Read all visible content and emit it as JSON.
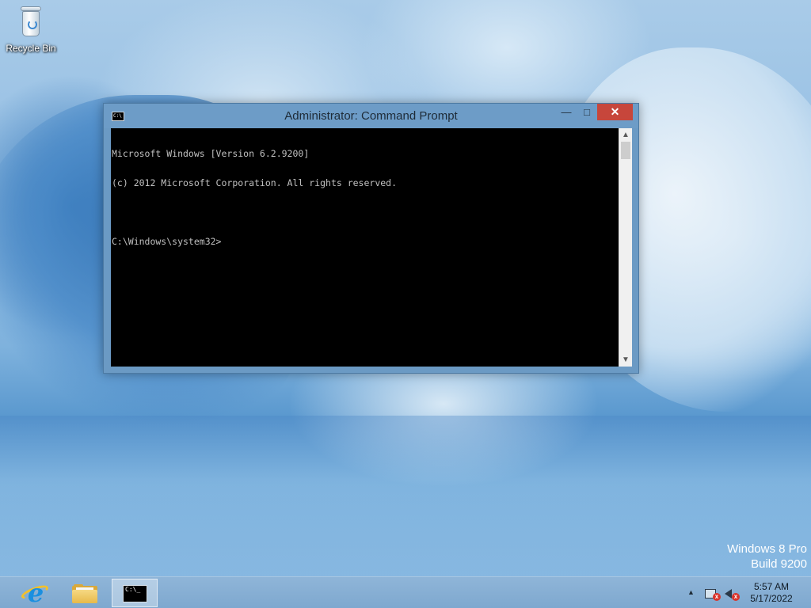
{
  "desktop": {
    "icons": [
      {
        "label": "Recycle Bin",
        "icon": "recycle-bin-icon"
      }
    ],
    "watermark": {
      "line1": "Windows 8 Pro",
      "line2": "Build 9200"
    }
  },
  "window": {
    "title": "Administrator: Command Prompt",
    "icon": "command-prompt-icon",
    "controls": {
      "minimize": "—",
      "maximize": "□",
      "close": "✕"
    },
    "console_lines": [
      "Microsoft Windows [Version 6.2.9200]",
      "(c) 2012 Microsoft Corporation. All rights reserved.",
      "",
      "C:\\Windows\\system32>"
    ],
    "scrollbar": {
      "up_arrow": "▲",
      "down_arrow": "▼"
    }
  },
  "taskbar": {
    "items": [
      {
        "name": "internet-explorer",
        "icon": "internet-explorer-icon",
        "active": false
      },
      {
        "name": "file-explorer",
        "icon": "file-explorer-icon",
        "active": false
      },
      {
        "name": "command-prompt",
        "icon": "command-prompt-icon",
        "active": true
      }
    ],
    "tray": {
      "show_hidden_arrow": "▲",
      "icons": [
        "network-error-icon",
        "volume-muted-icon"
      ],
      "time": "5:57 AM",
      "date": "5/17/2022"
    }
  },
  "colors": {
    "titlebar": "#6d9cc7",
    "close_button": "#c7463b",
    "console_bg": "#000000",
    "console_fg": "#c0c0c0",
    "taskbar": "#8fb5d8"
  }
}
